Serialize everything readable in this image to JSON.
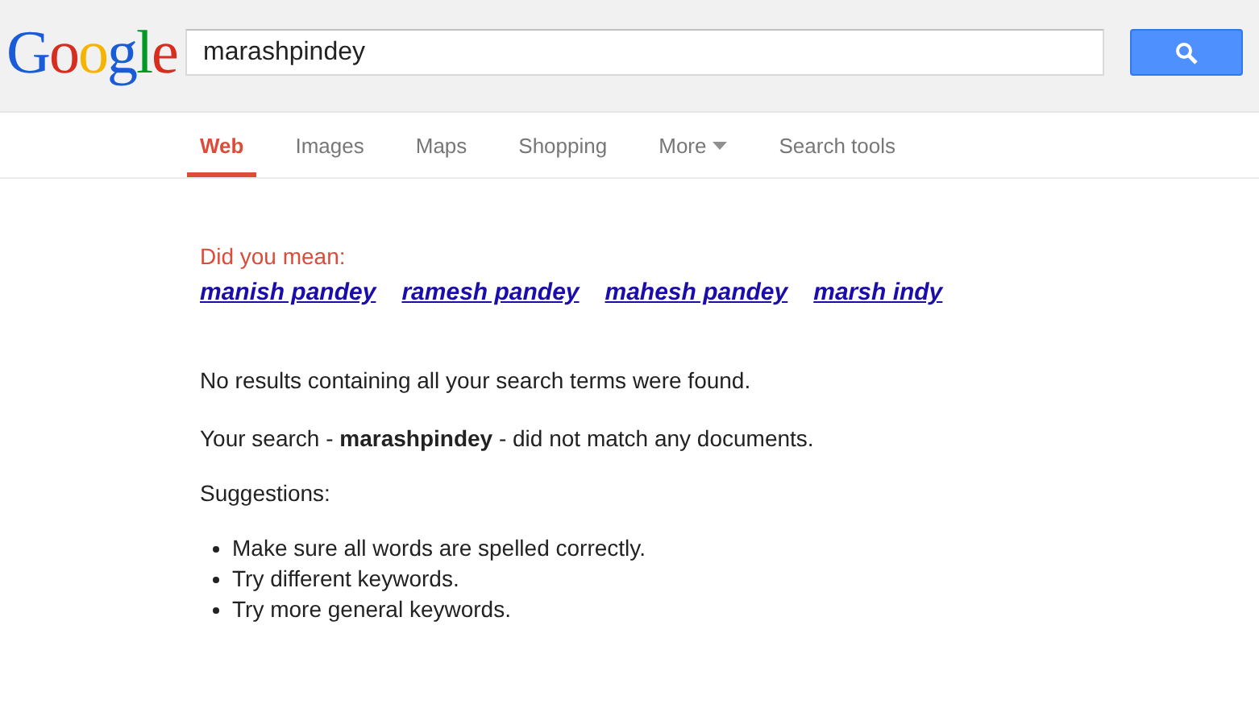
{
  "logo": "Google",
  "search": {
    "value": "marashpindey"
  },
  "tabs": [
    {
      "label": "Web",
      "selected": true,
      "kind": "tab"
    },
    {
      "label": "Images",
      "selected": false,
      "kind": "tab"
    },
    {
      "label": "Maps",
      "selected": false,
      "kind": "tab"
    },
    {
      "label": "Shopping",
      "selected": false,
      "kind": "tab"
    },
    {
      "label": "More",
      "selected": false,
      "kind": "menu"
    },
    {
      "label": "Search tools",
      "selected": false,
      "kind": "tools"
    }
  ],
  "did_you_mean": {
    "label": "Did you mean:",
    "suggestions": [
      "manish pandey",
      "ramesh pandey",
      "mahesh pandey",
      "marsh indy"
    ]
  },
  "messages": [
    "No results containing all your search terms were found.",
    "Your search - **marashpindey** - did not match any documents."
  ],
  "suggestions": {
    "heading": "Suggestions:",
    "items": [
      "Make sure all words are spelled correctly.",
      "Try different keywords.",
      "Try more general keywords."
    ]
  }
}
